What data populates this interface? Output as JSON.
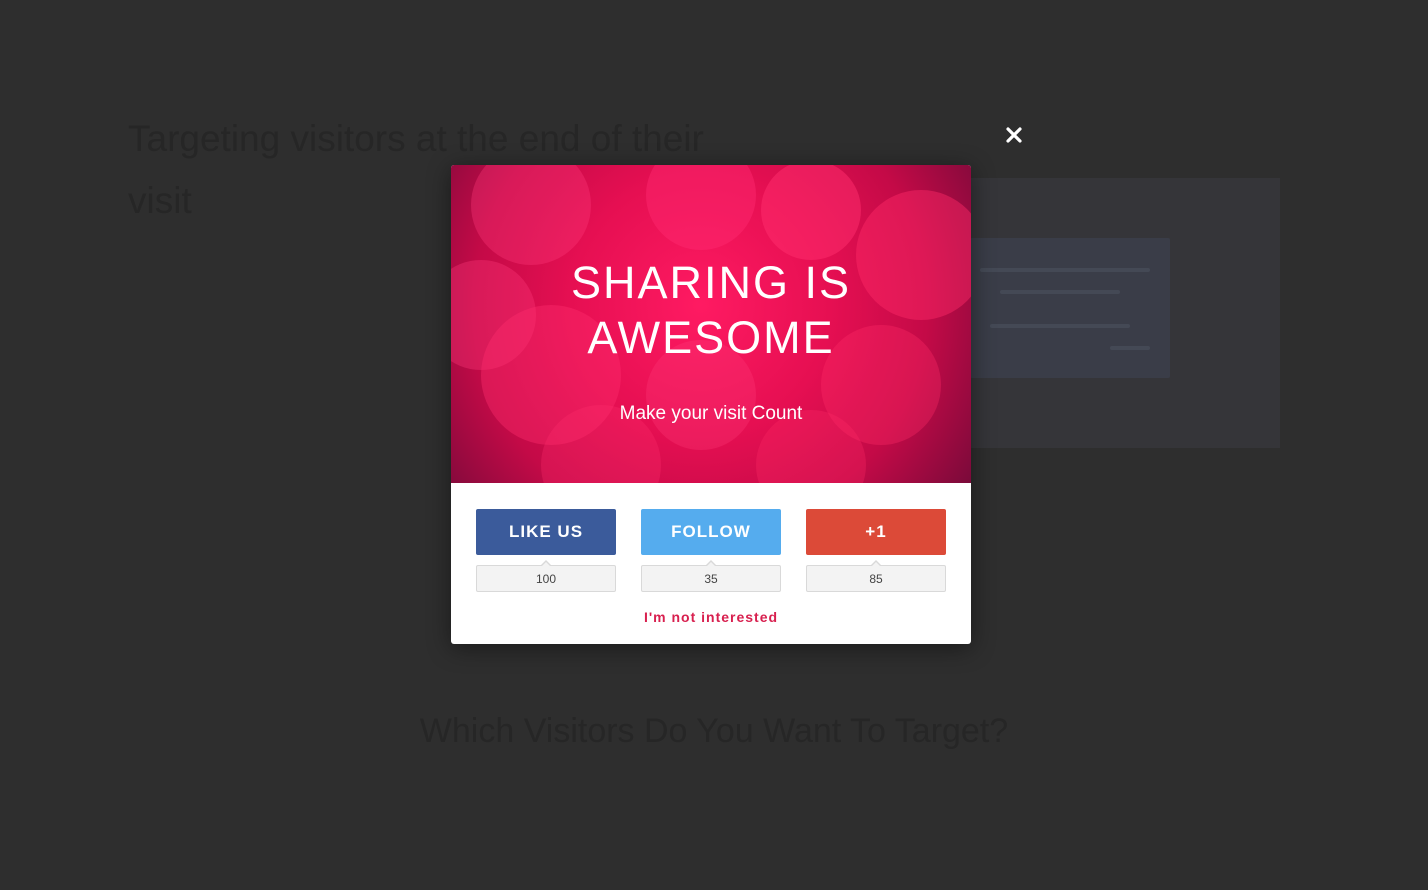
{
  "background": {
    "heading": "Targeting visitors at the end of their visit",
    "subtitle": "",
    "section_title": "Which Visitors Do You Want To Target?"
  },
  "modal": {
    "title": "SHARING IS AWESOME",
    "subtitle": "Make your visit Count",
    "buttons": [
      {
        "label": "LIKE US",
        "count": "100",
        "color": "#3b5b9b"
      },
      {
        "label": "FOLLOW",
        "count": "35",
        "color": "#55acee"
      },
      {
        "label": "+1",
        "count": "85",
        "color": "#dc4a38"
      }
    ],
    "dismiss_label": "I'm not interested",
    "accent_color": "#e8135a"
  },
  "icons": {
    "close": "close-icon"
  }
}
